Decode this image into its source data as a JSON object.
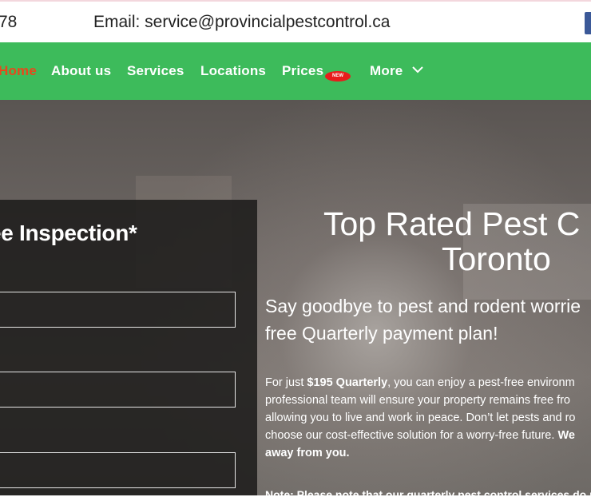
{
  "topbar": {
    "phone_fragment": "78",
    "email": "Email: service@provincialpestcontrol.ca"
  },
  "nav": {
    "items": [
      {
        "label": "Home"
      },
      {
        "label": "About us"
      },
      {
        "label": "Services"
      },
      {
        "label": "Locations"
      },
      {
        "label": "Prices"
      },
      {
        "label": "More"
      }
    ],
    "new_badge": "NEW"
  },
  "form": {
    "title": "ee Inspection*"
  },
  "hero": {
    "title_line1": "Top Rated Pest C",
    "title_line2": "Toronto",
    "sub_line1": "Say goodbye to pest and rodent worrie",
    "sub_line2": "free Quarterly payment plan!",
    "body": {
      "l1_pre": "For just ",
      "l1_bold": "$195 Quarterly",
      "l1_post": ", you can enjoy a pest-free environm",
      "l2": "professional team will ensure your property remains free fro",
      "l3": "allowing you to live and work in peace. Don’t let pests and ro",
      "l4_pre": "choose our cost-effective solution for a worry-free future. ",
      "l4_bold": "We",
      "l5_bold": "away from you."
    },
    "note_fragment": "Note: Please note that our quarterly pest control services do not"
  }
}
